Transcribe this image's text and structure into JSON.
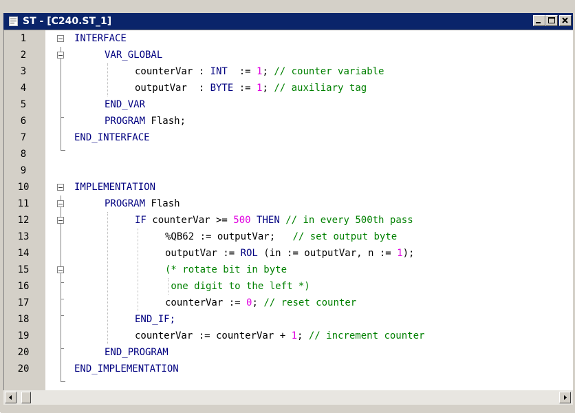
{
  "window": {
    "title": "ST - [C240.ST_1]",
    "title_icon": "document-icon",
    "controls": [
      "minimize-icon",
      "restore-icon",
      "close-icon"
    ]
  },
  "colors": {
    "keyword": "#000080",
    "number": "#e000e0",
    "comment": "#008000",
    "titlebar": "#0a246a"
  },
  "code": {
    "line_numbers": [
      "1",
      "2",
      "3",
      "4",
      "5",
      "6",
      "7",
      "8",
      "9",
      "10",
      "11",
      "12",
      "13",
      "14",
      "15",
      "16",
      "17",
      "18",
      "19",
      "20"
    ],
    "l1": "INTERFACE",
    "l2": "VAR_GLOBAL",
    "l3a": "counterVar : ",
    "l3b": "INT",
    "l3c": "  := ",
    "l3d": "1",
    "l3e": "; ",
    "l3f": "// counter variable",
    "l4a": "outputVar  : ",
    "l4b": "BYTE",
    "l4c": " := ",
    "l4d": "1",
    "l4e": "; ",
    "l4f": "// auxiliary tag",
    "l5": "END_VAR",
    "l6a": "PROGRAM",
    "l6b": " Flash;",
    "l7": "END_INTERFACE",
    "l9": "IMPLEMENTATION",
    "l10a": "PROGRAM",
    "l10b": " Flash",
    "l11a": "IF",
    "l11b": " counterVar >= ",
    "l11c": "500",
    "l11d": " ",
    "l11e": "THEN",
    "l11f": " ",
    "l11g": "// in every 500th pass",
    "l12a": "%QB62 := outputVar;   ",
    "l12b": "// set output byte",
    "l13a": "outputVar := ",
    "l13b": "ROL",
    "l13c": " (in := outputVar, n := ",
    "l13d": "1",
    "l13e": ");",
    "l14": "(* rotate bit in byte",
    "l15": " one digit to the left *)",
    "l16a": "counterVar := ",
    "l16b": "0",
    "l16c": "; ",
    "l16d": "// reset counter",
    "l17": "END_IF;",
    "l18a": "counterVar := counterVar + ",
    "l18b": "1",
    "l18c": "; ",
    "l18d": "// increment counter",
    "l19": "END_PROGRAM",
    "l20": "END_IMPLEMENTATION"
  },
  "scrollbar": {
    "left_arrow": "left-arrow-icon",
    "right_arrow": "right-arrow-icon"
  }
}
